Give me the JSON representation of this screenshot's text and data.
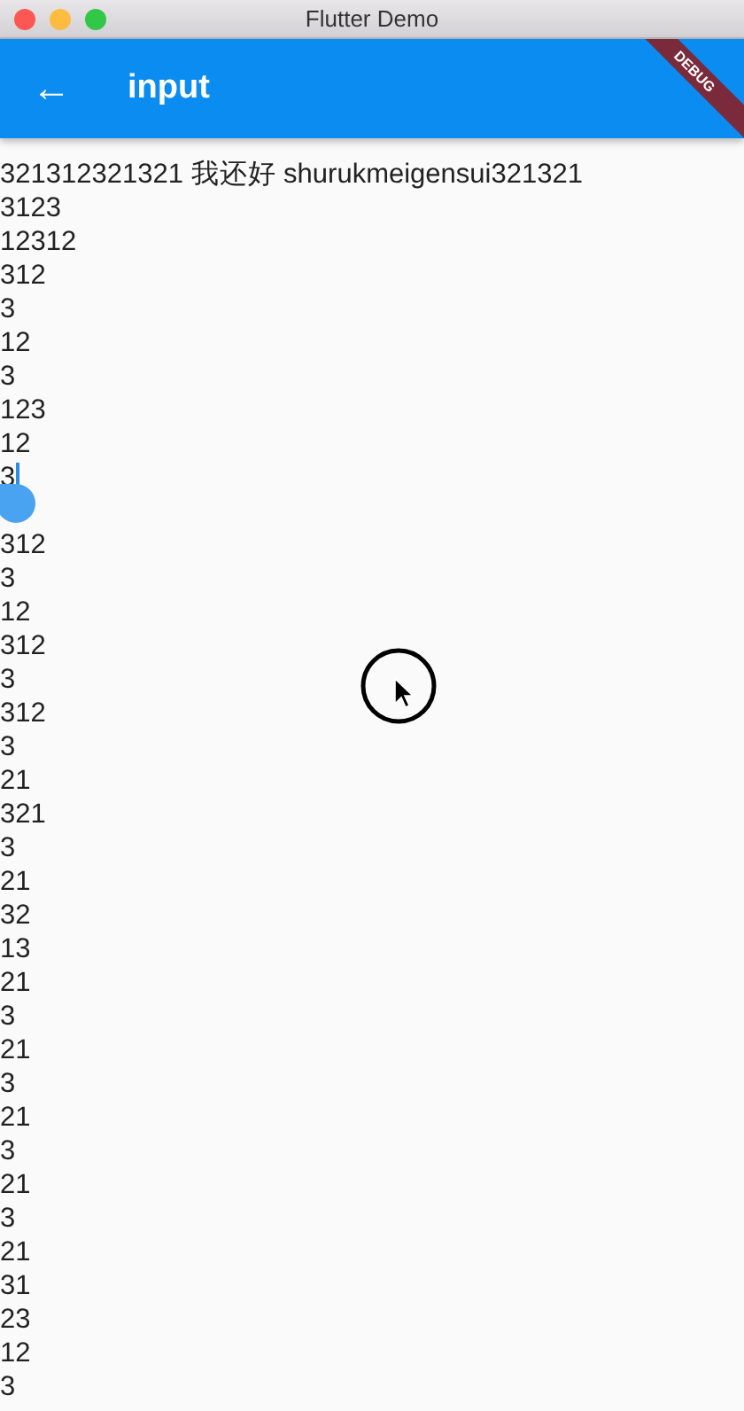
{
  "window": {
    "title": "Flutter Demo"
  },
  "app_bar": {
    "back": "←",
    "title": "input",
    "debug_banner": "DEBUG"
  },
  "text_field": {
    "lines": [
      {
        "text": "321312321321 我还好 shurukmeigensui321321",
        "cursor": false
      },
      {
        "text": "3123",
        "cursor": false
      },
      {
        "text": "12312",
        "cursor": false
      },
      {
        "text": "312",
        "cursor": false
      },
      {
        "text": "3",
        "cursor": false
      },
      {
        "text": "12",
        "cursor": false
      },
      {
        "text": "3",
        "cursor": false
      },
      {
        "text": "123",
        "cursor": false
      },
      {
        "text": "12",
        "cursor": false
      },
      {
        "text": "3",
        "cursor": true
      },
      {
        "text": "312",
        "cursor": false
      },
      {
        "text": "3",
        "cursor": false
      },
      {
        "text": "12",
        "cursor": false
      },
      {
        "text": "312",
        "cursor": false
      },
      {
        "text": "3",
        "cursor": false
      },
      {
        "text": "312",
        "cursor": false
      },
      {
        "text": "3",
        "cursor": false
      },
      {
        "text": "21",
        "cursor": false
      },
      {
        "text": "321",
        "cursor": false
      },
      {
        "text": "3",
        "cursor": false
      },
      {
        "text": "21",
        "cursor": false
      },
      {
        "text": "32",
        "cursor": false
      },
      {
        "text": "13",
        "cursor": false
      },
      {
        "text": "21",
        "cursor": false
      },
      {
        "text": "3",
        "cursor": false
      },
      {
        "text": "21",
        "cursor": false
      },
      {
        "text": "3",
        "cursor": false
      },
      {
        "text": "21",
        "cursor": false
      },
      {
        "text": "3",
        "cursor": false
      },
      {
        "text": "21",
        "cursor": false
      },
      {
        "text": "3",
        "cursor": false
      },
      {
        "text": "21",
        "cursor": false
      },
      {
        "text": "31",
        "cursor": false
      },
      {
        "text": "23",
        "cursor": false
      },
      {
        "text": "12",
        "cursor": false
      },
      {
        "text": "3",
        "cursor": false
      }
    ]
  }
}
